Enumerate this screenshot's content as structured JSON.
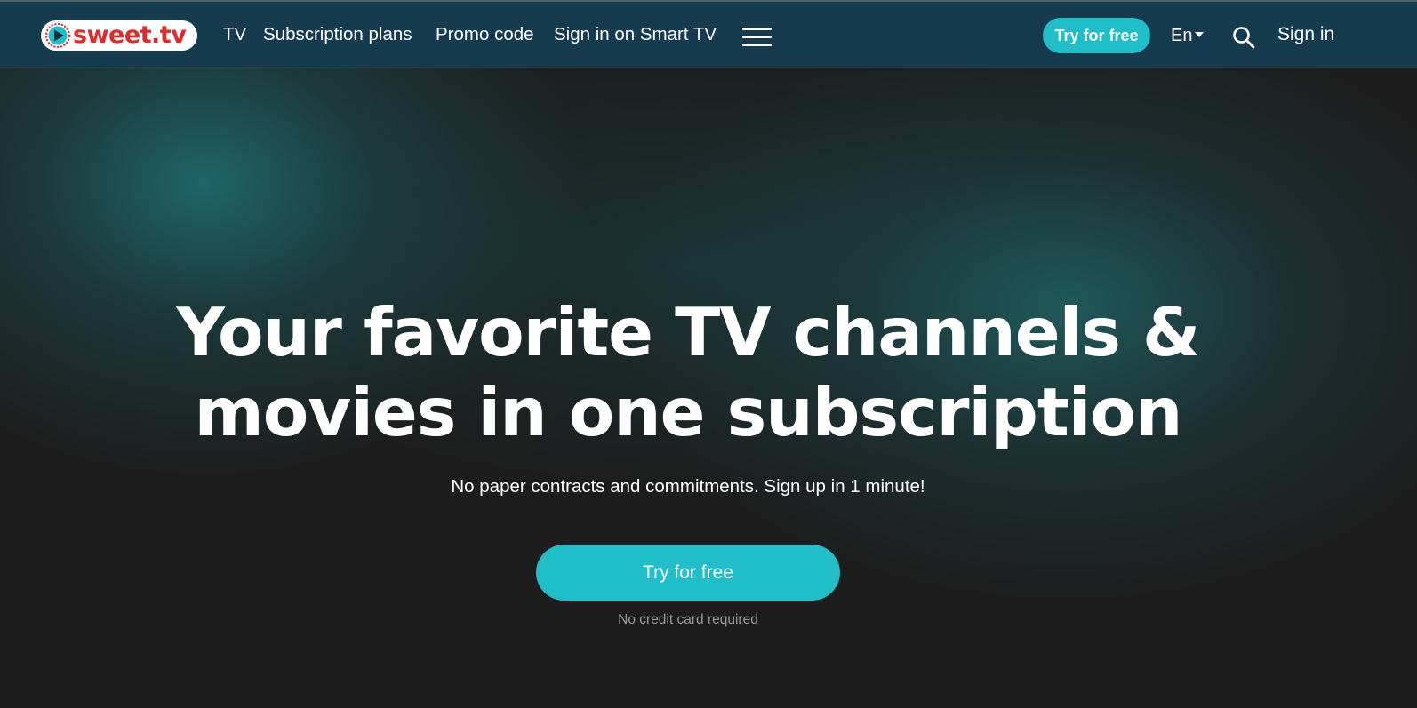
{
  "header": {
    "logo_text": "sweet.tv",
    "nav": [
      {
        "label": "TV"
      },
      {
        "label": "Subscription plans"
      },
      {
        "label": "Promo code"
      },
      {
        "label": "Sign in on Smart TV"
      }
    ],
    "menu_icon": "hamburger-menu-icon",
    "cta_label": "Try for free",
    "language": "En",
    "search_icon": "search-icon",
    "signin_label": "Sign in"
  },
  "hero": {
    "headline_line1": "Your favorite TV channels &",
    "headline_line2": "movies in one subscription",
    "subtitle": "No paper contracts and commitments. Sign up in 1 minute!",
    "cta_label": "Try for free",
    "note": "No credit card required"
  },
  "colors": {
    "header_bg": "#163a4e",
    "accent": "#1fbec8",
    "logo_red": "#dc2b28",
    "page_bg": "#1d1d1d"
  }
}
